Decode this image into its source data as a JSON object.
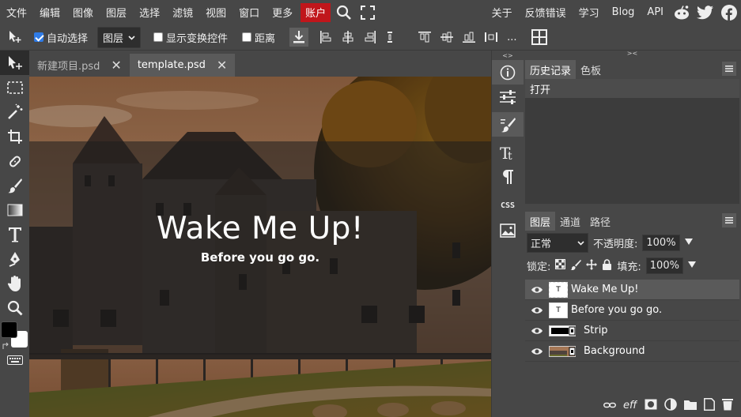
{
  "menu": {
    "items": [
      "文件",
      "编辑",
      "图像",
      "图层",
      "选择",
      "滤镜",
      "视图",
      "窗口",
      "更多"
    ],
    "account": "账户",
    "right_items": [
      "关于",
      "反馈错误",
      "学习",
      "Blog",
      "API"
    ]
  },
  "options": {
    "auto_select": "自动选择",
    "layer_select": "图层",
    "show_transform": "显示变换控件",
    "distance": "距离",
    "more": "..."
  },
  "tabs": [
    {
      "label": "新建项目.psd"
    },
    {
      "label": "template.psd"
    }
  ],
  "canvas": {
    "title": "Wake Me Up!",
    "subtitle": "Before you go go."
  },
  "history_panel": {
    "tabs": [
      "历史记录",
      "色板"
    ],
    "rows": [
      "打开"
    ]
  },
  "layers_panel": {
    "tabs": [
      "图层",
      "通道",
      "路径"
    ],
    "blend_mode": "正常",
    "opacity_label": "不透明度:",
    "opacity_value": "100%",
    "lock_label": "锁定:",
    "fill_label": "填充:",
    "fill_value": "100%",
    "layers": [
      {
        "name": "Wake Me Up!",
        "type": "T"
      },
      {
        "name": "Before you go go.",
        "type": "T"
      },
      {
        "name": "Strip",
        "type": ""
      },
      {
        "name": "Background",
        "type": ""
      }
    ]
  },
  "mid_strip": {
    "css_label": "CSS"
  },
  "colors": {
    "accent": "#c0161b",
    "selected": "#5a5a5a",
    "background": "#474747"
  }
}
